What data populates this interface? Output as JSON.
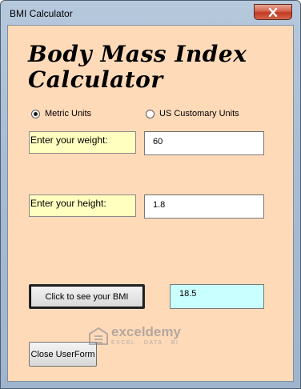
{
  "window": {
    "title": "BMI Calculator",
    "close_icon": "close-x-icon"
  },
  "form": {
    "heading_line1": "Body Mass Index",
    "heading_line2": "Calculator",
    "units": {
      "metric_label": "Metric Units",
      "us_label": "US Customary Units",
      "selected": "metric"
    },
    "weight": {
      "label": "Enter your weight:",
      "value": "60"
    },
    "height": {
      "label": "Enter your height:",
      "value": "1.8"
    },
    "calc_button_label": "Click to see your BMI",
    "result_value": "18.5",
    "close_button_label": "Close UserForm"
  },
  "watermark": {
    "name": "exceldemy",
    "tagline": "EXCEL · DATA · BI"
  },
  "colors": {
    "form_background": "#ffdab9",
    "label_background": "#ffffc0",
    "result_background": "#c9ffff",
    "close_button": "#c94a33"
  }
}
